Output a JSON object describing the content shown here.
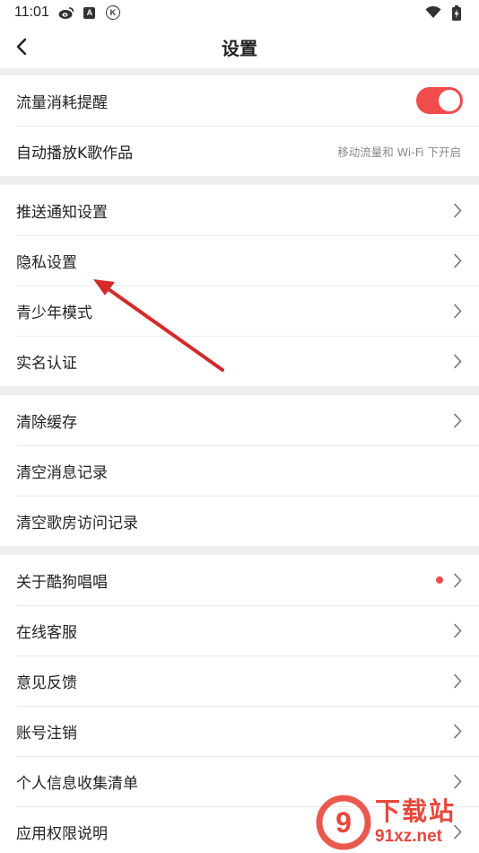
{
  "status_bar": {
    "time": "11:01",
    "icons": [
      "weibo-icon",
      "a-box-icon",
      "k-circle-icon",
      "wifi-icon",
      "battery-charging-icon"
    ],
    "a_box_text": "A",
    "k_circle_text": "K"
  },
  "header": {
    "title": "设置"
  },
  "groups": [
    {
      "rows": [
        {
          "label": "流量消耗提醒",
          "control": "toggle",
          "on": true
        },
        {
          "label": "自动播放K歌作品",
          "note": "移动流量和 Wi-Fi 下开启"
        }
      ]
    },
    {
      "rows": [
        {
          "label": "推送通知设置"
        },
        {
          "label": "隐私设置"
        },
        {
          "label": "青少年模式"
        },
        {
          "label": "实名认证"
        }
      ]
    },
    {
      "rows": [
        {
          "label": "清除缓存"
        },
        {
          "label": "清空消息记录"
        },
        {
          "label": "清空歌房访问记录"
        }
      ]
    },
    {
      "rows": [
        {
          "label": "关于酷狗唱唱",
          "badge_dot": true
        },
        {
          "label": "在线客服"
        },
        {
          "label": "意见反馈"
        },
        {
          "label": "账号注销"
        },
        {
          "label": "个人信息收集清单"
        },
        {
          "label": "应用权限说明"
        }
      ]
    }
  ],
  "watermark": {
    "logo_text": "9",
    "big": "下载站",
    "small": "91xz.net"
  },
  "colors": {
    "accent": "#f04c4c",
    "divider": "#efefef",
    "arrow": "#d42a2a"
  }
}
